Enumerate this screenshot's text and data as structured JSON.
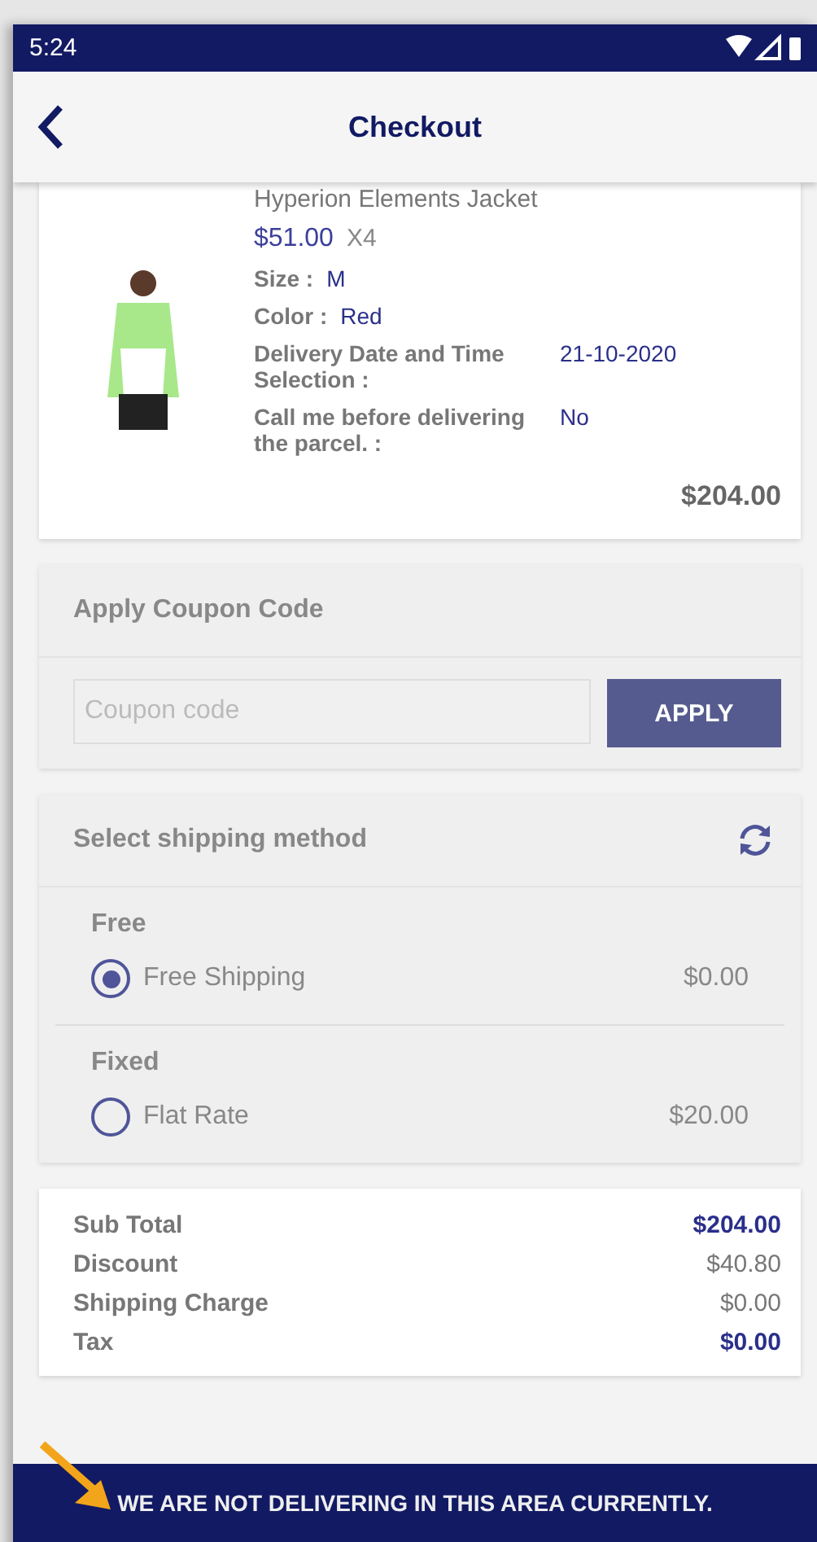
{
  "status_bar": {
    "time": "5:24"
  },
  "header": {
    "title": "Checkout"
  },
  "product": {
    "name": "Hyperion Elements Jacket",
    "price": "$51.00",
    "quantity": "X4",
    "attributes": [
      {
        "label": "Size :",
        "value": "M"
      },
      {
        "label": "Color :",
        "value": "Red"
      },
      {
        "label": "Delivery Date and Time Selection :",
        "value": "21-10-2020"
      },
      {
        "label": "Call me before delivering the parcel. :",
        "value": "No"
      }
    ],
    "total": "$204.00"
  },
  "coupon": {
    "title": "Apply Coupon Code",
    "placeholder": "Coupon code",
    "button": "APPLY"
  },
  "shipping": {
    "title": "Select shipping method",
    "groups": [
      {
        "name": "Free",
        "options": [
          {
            "label": "Free Shipping",
            "price": "$0.00",
            "selected": true
          }
        ]
      },
      {
        "name": "Fixed",
        "options": [
          {
            "label": "Flat Rate",
            "price": "$20.00",
            "selected": false
          }
        ]
      }
    ]
  },
  "totals": [
    {
      "label": "Sub Total",
      "value": "$204.00",
      "emphasis": true
    },
    {
      "label": "Discount",
      "value": "$40.80",
      "emphasis": false
    },
    {
      "label": "Shipping Charge",
      "value": "$0.00",
      "emphasis": false
    },
    {
      "label": "Tax",
      "value": "$0.00",
      "emphasis": true
    }
  ],
  "banner": {
    "message": "WE ARE NOT DELIVERING IN THIS AREA CURRENTLY."
  }
}
